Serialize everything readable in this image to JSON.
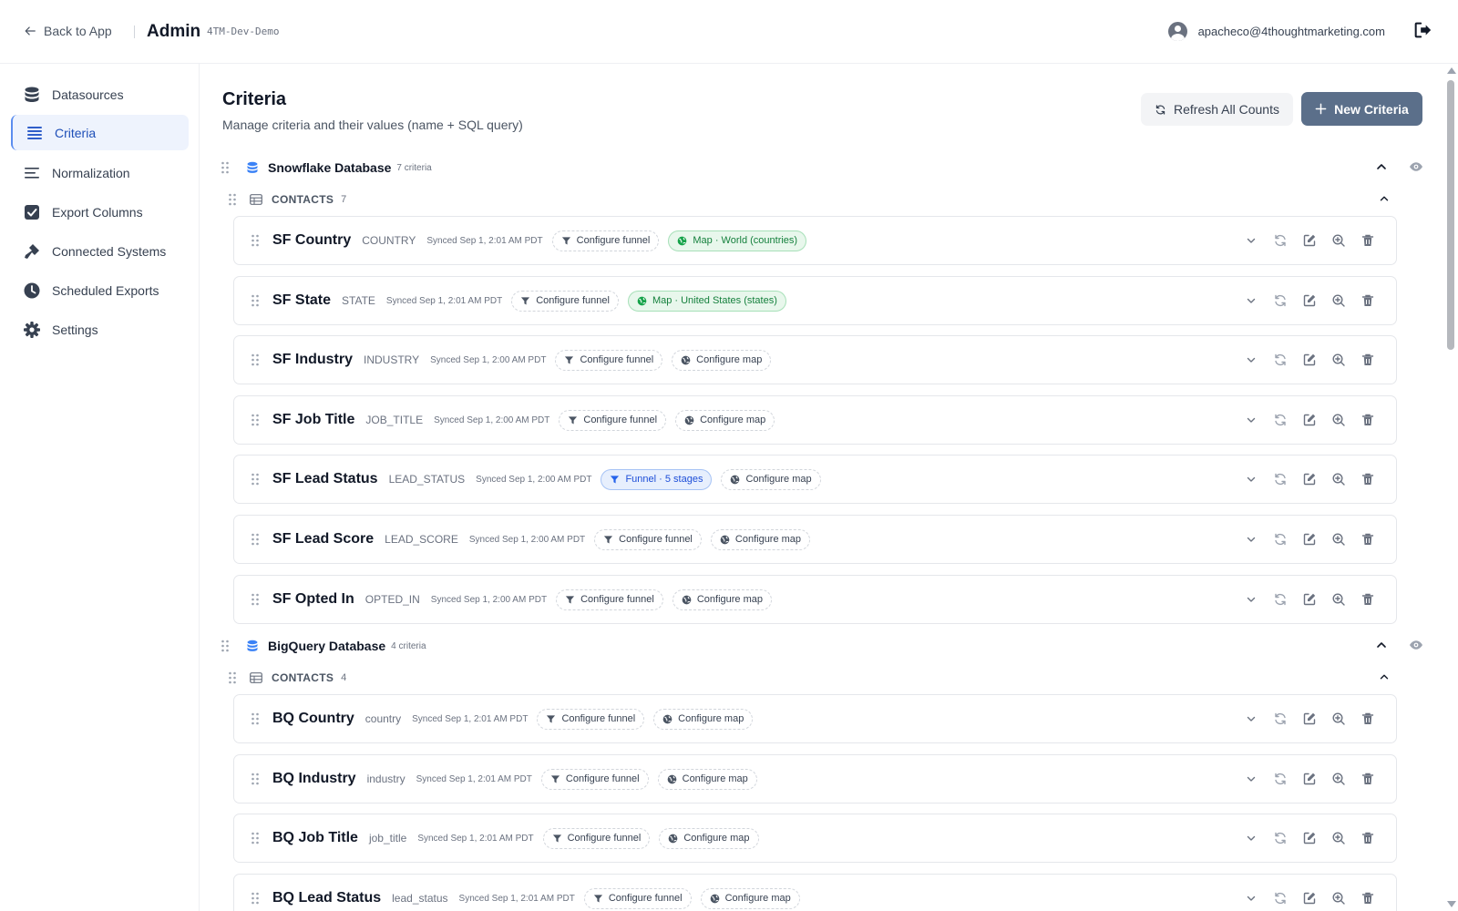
{
  "header": {
    "back_label": "Back to App",
    "title": "Admin",
    "tenant": "4TM-Dev-Demo",
    "user_email": "apacheco@4thoughtmarketing.com"
  },
  "sidebar": {
    "items": [
      {
        "label": "Datasources",
        "icon": "database-icon"
      },
      {
        "label": "Criteria",
        "icon": "list-icon",
        "active": true
      },
      {
        "label": "Normalization",
        "icon": "align-left-icon"
      },
      {
        "label": "Export Columns",
        "icon": "checkbox-icon"
      },
      {
        "label": "Connected Systems",
        "icon": "plug-icon"
      },
      {
        "label": "Scheduled Exports",
        "icon": "clock-icon"
      },
      {
        "label": "Settings",
        "icon": "gear-icon"
      }
    ]
  },
  "page": {
    "title": "Criteria",
    "subtitle": "Manage criteria and their values (name + SQL query)",
    "refresh_label": "Refresh All Counts",
    "new_label": "New Criteria"
  },
  "groups": [
    {
      "name": "Snowflake Database",
      "count": "7 criteria",
      "table": {
        "name": "CONTACTS",
        "count": "7"
      },
      "criteria": [
        {
          "name": "SF Country",
          "column": "COUNTRY",
          "synced": "Synced Sep 1, 2:01 AM PDT",
          "funnel": "Configure funnel",
          "funnel_state": "default",
          "map": "Map · World (countries)",
          "map_state": "configured"
        },
        {
          "name": "SF State",
          "column": "STATE",
          "synced": "Synced Sep 1, 2:01 AM PDT",
          "funnel": "Configure funnel",
          "funnel_state": "default",
          "map": "Map · United States (states)",
          "map_state": "configured"
        },
        {
          "name": "SF Industry",
          "column": "INDUSTRY",
          "synced": "Synced Sep 1, 2:00 AM PDT",
          "funnel": "Configure funnel",
          "funnel_state": "default",
          "map": "Configure map",
          "map_state": "default"
        },
        {
          "name": "SF Job Title",
          "column": "JOB_TITLE",
          "synced": "Synced Sep 1, 2:00 AM PDT",
          "funnel": "Configure funnel",
          "funnel_state": "default",
          "map": "Configure map",
          "map_state": "default"
        },
        {
          "name": "SF Lead Status",
          "column": "LEAD_STATUS",
          "synced": "Synced Sep 1, 2:00 AM PDT",
          "funnel": "Funnel · 5 stages",
          "funnel_state": "configured",
          "map": "Configure map",
          "map_state": "default"
        },
        {
          "name": "SF Lead Score",
          "column": "LEAD_SCORE",
          "synced": "Synced Sep 1, 2:00 AM PDT",
          "funnel": "Configure funnel",
          "funnel_state": "default",
          "map": "Configure map",
          "map_state": "default"
        },
        {
          "name": "SF Opted In",
          "column": "OPTED_IN",
          "synced": "Synced Sep 1, 2:00 AM PDT",
          "funnel": "Configure funnel",
          "funnel_state": "default",
          "map": "Configure map",
          "map_state": "default"
        }
      ]
    },
    {
      "name": "BigQuery Database",
      "count": "4 criteria",
      "table": {
        "name": "CONTACTS",
        "count": "4"
      },
      "criteria": [
        {
          "name": "BQ Country",
          "column": "country",
          "synced": "Synced Sep 1, 2:01 AM PDT",
          "funnel": "Configure funnel",
          "funnel_state": "default",
          "map": "Configure map",
          "map_state": "default"
        },
        {
          "name": "BQ Industry",
          "column": "industry",
          "synced": "Synced Sep 1, 2:01 AM PDT",
          "funnel": "Configure funnel",
          "funnel_state": "default",
          "map": "Configure map",
          "map_state": "default"
        },
        {
          "name": "BQ Job Title",
          "column": "job_title",
          "synced": "Synced Sep 1, 2:01 AM PDT",
          "funnel": "Configure funnel",
          "funnel_state": "default",
          "map": "Configure map",
          "map_state": "default"
        },
        {
          "name": "BQ Lead Status",
          "column": "lead_status",
          "synced": "Synced Sep 1, 2:01 AM PDT",
          "funnel": "Configure funnel",
          "funnel_state": "default",
          "map": "Configure map",
          "map_state": "default"
        }
      ]
    }
  ],
  "colors": {
    "accent": "#5b6f8a",
    "active_nav_bg": "#eef3fd",
    "active_nav_text": "#1e4fb8",
    "db_icon": "#3b82f6",
    "configured_map": "#15803d",
    "configured_funnel": "#1d4ed8"
  }
}
